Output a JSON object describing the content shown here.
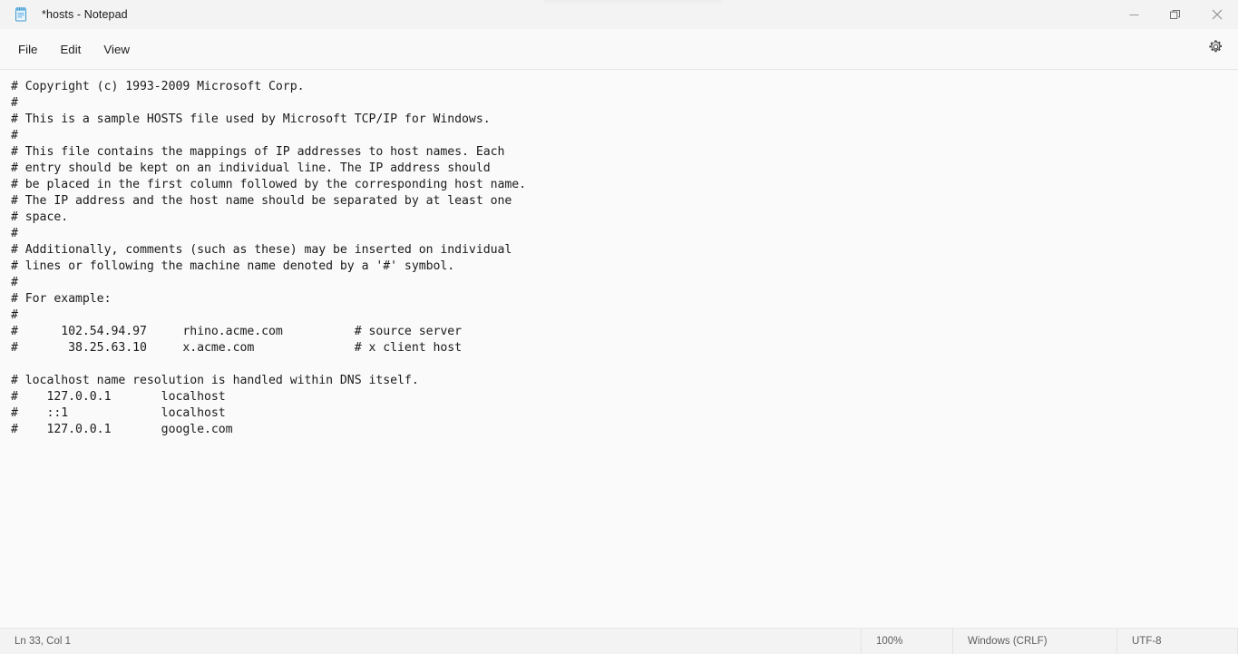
{
  "window": {
    "title": "*hosts - Notepad",
    "app_icon": "notepad-icon",
    "controls": {
      "minimize": "minimize-icon",
      "maximize": "restore-icon",
      "close": "close-icon"
    }
  },
  "menubar": {
    "items": [
      {
        "label": "File"
      },
      {
        "label": "Edit"
      },
      {
        "label": "View"
      }
    ],
    "settings_icon": "gear-icon"
  },
  "editor": {
    "content": "# Copyright (c) 1993-2009 Microsoft Corp.\n#\n# This is a sample HOSTS file used by Microsoft TCP/IP for Windows.\n#\n# This file contains the mappings of IP addresses to host names. Each\n# entry should be kept on an individual line. The IP address should\n# be placed in the first column followed by the corresponding host name.\n# The IP address and the host name should be separated by at least one\n# space.\n#\n# Additionally, comments (such as these) may be inserted on individual\n# lines or following the machine name denoted by a '#' symbol.\n#\n# For example:\n#\n#      102.54.94.97     rhino.acme.com          # source server\n#       38.25.63.10     x.acme.com              # x client host\n\n# localhost name resolution is handled within DNS itself.\n#    127.0.0.1       localhost\n#    ::1             localhost\n#    127.0.0.1       google.com\n"
  },
  "statusbar": {
    "cursor_position": "Ln 33, Col 1",
    "zoom": "100%",
    "line_ending": "Windows (CRLF)",
    "encoding": "UTF-8"
  },
  "colors": {
    "chrome": "#f3f3f3",
    "menubar": "#f9f9f9",
    "editor_bg": "#fafafa",
    "text": "#1b1b1b",
    "status_text": "#5d5d5d",
    "icon_blue": "#4aa3df",
    "close_hover": "#e81123"
  }
}
